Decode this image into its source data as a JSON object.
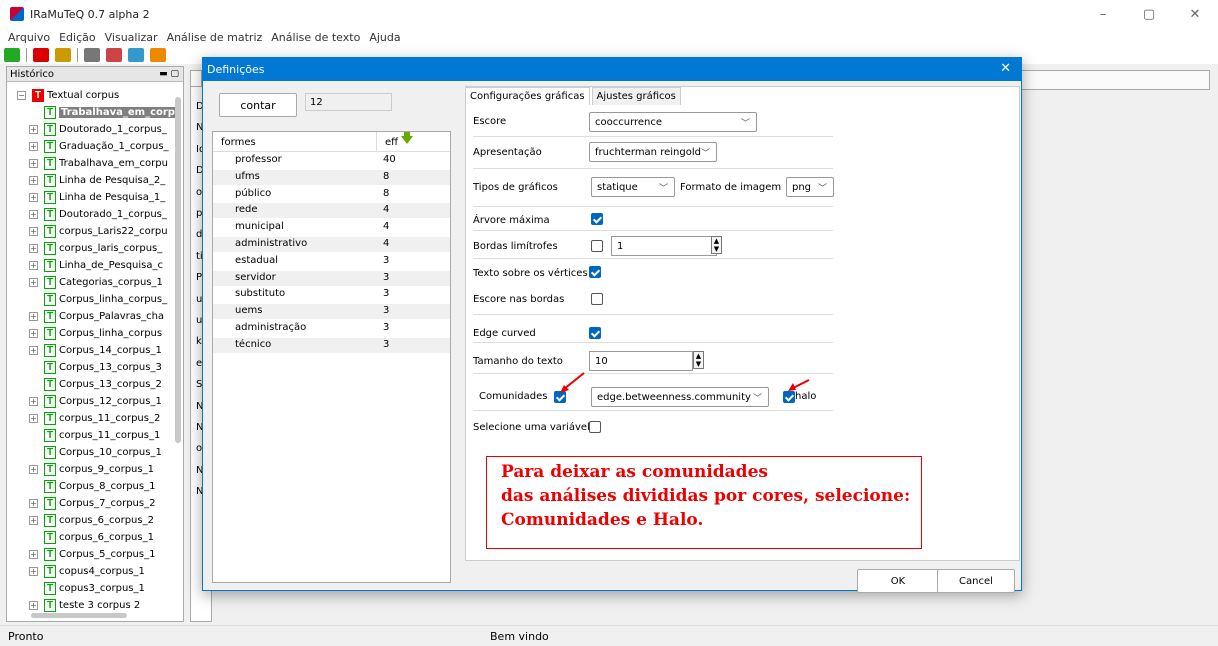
{
  "window": {
    "title": "IRaMuTeQ 0.7 alpha 2",
    "controls": [
      "–",
      "▢",
      "✕"
    ]
  },
  "menu": [
    "Arquivo",
    "Edição",
    "Visualizar",
    "Análise de matriz",
    "Análise de texto",
    "Ajuda"
  ],
  "left_panel": {
    "title": "Histórico",
    "tree": [
      {
        "label": "Textual corpus",
        "root": true,
        "expander": "−"
      },
      {
        "label": "Trabalhava_em_corp",
        "selected": true
      },
      {
        "label": "Doutorado_1_corpus_",
        "expander": "+"
      },
      {
        "label": "Graduação_1_corpus_",
        "expander": "+"
      },
      {
        "label": "Trabalhava_em_corpu",
        "expander": "+"
      },
      {
        "label": "Linha de Pesquisa_2_",
        "expander": "+"
      },
      {
        "label": "Linha de Pesquisa_1_",
        "expander": "+"
      },
      {
        "label": "Doutorado_1_corpus_",
        "expander": "+"
      },
      {
        "label": "corpus_Laris22_corpu",
        "expander": "+"
      },
      {
        "label": "corpus_laris_corpus_",
        "expander": "+"
      },
      {
        "label": "Linha_de_Pesquisa_c",
        "expander": "+"
      },
      {
        "label": "Categorias_corpus_1",
        "expander": "+"
      },
      {
        "label": "Corpus_linha_corpus_"
      },
      {
        "label": "Corpus_Palavras_cha",
        "expander": "+"
      },
      {
        "label": "Corpus_linha_corpus",
        "expander": "+"
      },
      {
        "label": "Corpus_14_corpus_1",
        "expander": "+"
      },
      {
        "label": "Corpus_13_corpus_3"
      },
      {
        "label": "Corpus_13_corpus_2"
      },
      {
        "label": "Corpus_12_corpus_1",
        "expander": "+"
      },
      {
        "label": "corpus_11_corpus_2",
        "expander": "+"
      },
      {
        "label": "corpus_11_corpus_1"
      },
      {
        "label": "Corpus_10_corpus_1"
      },
      {
        "label": "corpus_9_corpus_1",
        "expander": "+"
      },
      {
        "label": "Corpus_8_corpus_1"
      },
      {
        "label": "Corpus_7_corpus_2",
        "expander": "+"
      },
      {
        "label": "corpus_6_corpus_2",
        "expander": "+"
      },
      {
        "label": "corpus_6_corpus_1"
      },
      {
        "label": "Corpus_5_corpus_1",
        "expander": "+"
      },
      {
        "label": "copus4_corpus_1",
        "expander": "+"
      },
      {
        "label": "copus3_corpus_1"
      },
      {
        "label": "teste 3 corpus 2",
        "expander": "+"
      }
    ]
  },
  "background_letters": [
    "D",
    "N",
    "Id",
    "D",
    "o",
    "p",
    "d",
    "ti",
    "P",
    "u",
    "u",
    "ke",
    "e",
    "Si",
    "N",
    "N",
    "o",
    "N",
    "N"
  ],
  "status": {
    "left": "Pronto",
    "right": "Bem vindo"
  },
  "dialog": {
    "title": "Definições",
    "count_button": "contar",
    "count_value": "12",
    "forms_header": {
      "word": "formes",
      "count": "eff"
    },
    "forms": [
      {
        "w": "professor",
        "n": "40"
      },
      {
        "w": "ufms",
        "n": "8"
      },
      {
        "w": "público",
        "n": "8"
      },
      {
        "w": "rede",
        "n": "4"
      },
      {
        "w": "municipal",
        "n": "4"
      },
      {
        "w": "administrativo",
        "n": "4"
      },
      {
        "w": "estadual",
        "n": "3"
      },
      {
        "w": "servidor",
        "n": "3"
      },
      {
        "w": "substituto",
        "n": "3"
      },
      {
        "w": "uems",
        "n": "3"
      },
      {
        "w": "administração",
        "n": "3"
      },
      {
        "w": "técnico",
        "n": "3"
      }
    ],
    "tabs": [
      "Configurações gráficas",
      "Ajustes gráficos"
    ],
    "settings": {
      "score_label": "Escore",
      "score_value": "cooccurrence",
      "presentation_label": "Apresentação",
      "presentation_value": "fruchterman reingold",
      "graph_type_label": "Tipos de gráficos",
      "graph_type_value": "statique",
      "image_format_label": "Formato de imagem",
      "image_format_value": "png",
      "max_tree_label": "Árvore máxima",
      "max_tree_checked": true,
      "borders_label": "Bordas limítrofes",
      "borders_checked": false,
      "borders_value": "1",
      "vertex_text_label": "Texto sobre os vértices",
      "vertex_text_checked": true,
      "edge_score_label": "Escore nas bordas",
      "edge_score_checked": false,
      "edge_curved_label": "Edge curved",
      "edge_curved_checked": true,
      "text_size_label": "Tamanho do texto",
      "text_size_value": "10",
      "communities_label": "Comunidades",
      "communities_checked": true,
      "communities_value": "edge.betweenness.community",
      "halo_label": "halo",
      "halo_checked": true,
      "variable_label": "Selecione uma variável",
      "variable_checked": false
    },
    "annotation": [
      "Para deixar as comunidades",
      "das análises divididas por cores, selecione:",
      "Comunidades e Halo."
    ],
    "ok_label": "OK",
    "cancel_label": "Cancel"
  },
  "colors": {
    "accent": "#0078d4",
    "annotation_red": "#e00000",
    "checkbox_blue": "#0067c0"
  }
}
